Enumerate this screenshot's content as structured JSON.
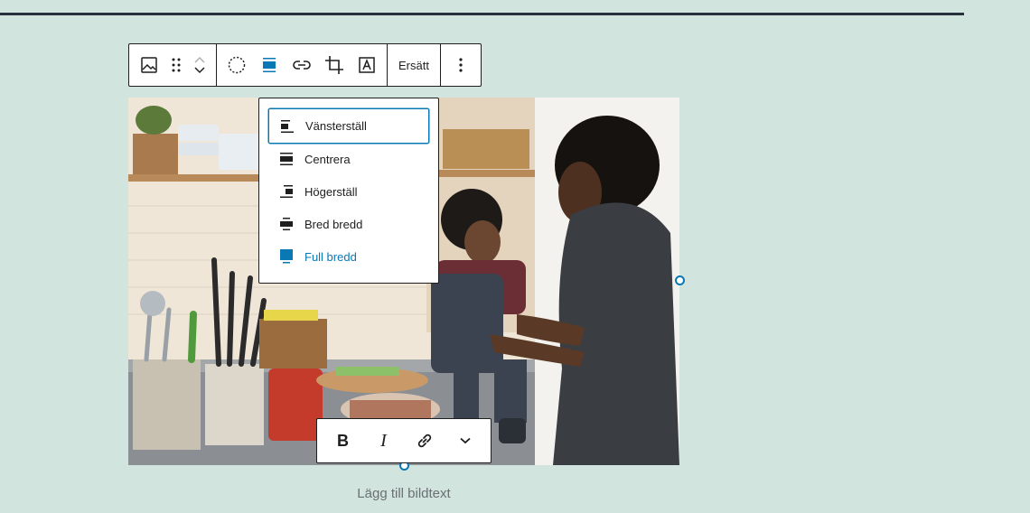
{
  "toolbar": {
    "block_type_icon": "image-icon",
    "drag_icon": "drag-handle-icon",
    "move_up_icon": "chevron-up-icon",
    "move_down_icon": "chevron-down-icon",
    "duotone_icon": "duotone-icon",
    "align_icon": "align-full-icon",
    "link_icon": "link-icon",
    "crop_icon": "crop-icon",
    "text_overlay_icon": "text-over-image-icon",
    "replace_label": "Ersätt",
    "more_icon": "more-vertical-icon"
  },
  "align_menu": {
    "items": [
      {
        "label": "Vänsterställ",
        "icon": "align-left-icon",
        "state": "focused"
      },
      {
        "label": "Centrera",
        "icon": "align-center-icon",
        "state": ""
      },
      {
        "label": "Högerställ",
        "icon": "align-right-icon",
        "state": ""
      },
      {
        "label": "Bred bredd",
        "icon": "align-wide-icon",
        "state": ""
      },
      {
        "label": "Full bredd",
        "icon": "align-full-icon",
        "state": "active"
      }
    ]
  },
  "format_toolbar": {
    "bold_label": "B",
    "italic_label": "I",
    "link_icon": "link-icon",
    "more_icon": "chevron-down-icon"
  },
  "caption": {
    "placeholder": "Lägg till bildtext"
  },
  "colors": {
    "background": "#d1e4dd",
    "accent": "#0a78b4",
    "border": "#1e1e1e"
  }
}
